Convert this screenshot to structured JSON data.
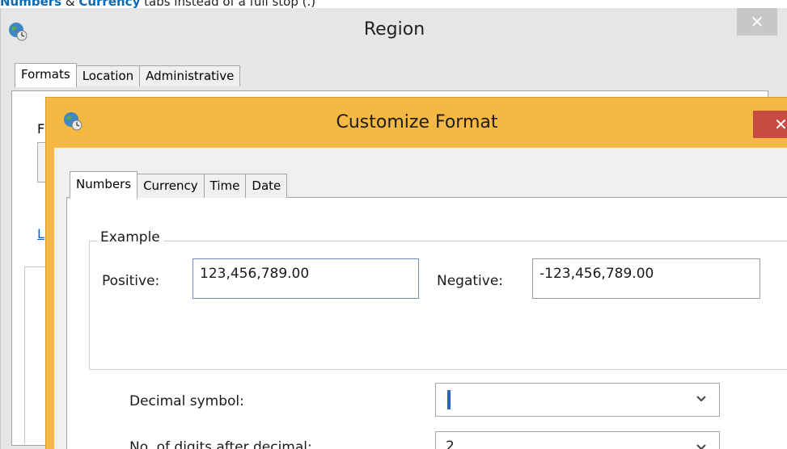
{
  "caption": {
    "highlight1": "Numbers",
    "connector": " & ",
    "highlight2": "Currency",
    "rest": " tabs instead of a full stop (.)"
  },
  "region_window": {
    "title": "Region",
    "close_glyph": "✕",
    "tabs": [
      {
        "label": "Formats",
        "active": true
      },
      {
        "label": "Location",
        "active": false
      },
      {
        "label": "Administrative",
        "active": false
      }
    ],
    "partial_format_label": "F",
    "partial_link": "L"
  },
  "customize_window": {
    "title": "Customize Format",
    "close_glyph": "✕",
    "tabs": [
      {
        "label": "Numbers",
        "active": true
      },
      {
        "label": "Currency",
        "active": false
      },
      {
        "label": "Time",
        "active": false
      },
      {
        "label": "Date",
        "active": false
      }
    ],
    "example": {
      "legend": "Example",
      "positive_label": "Positive:",
      "positive_value": "123,456,789.00",
      "negative_label": "Negative:",
      "negative_value": "-123,456,789.00"
    },
    "decimal_symbol_label": "Decimal symbol:",
    "digits_after_decimal_label": "No. of digits after decimal:",
    "digits_after_decimal_value": "2"
  },
  "icons": {
    "app": "globe-clock-icon",
    "dropdown": "chevron-down-icon",
    "close": "close-icon"
  },
  "colors": {
    "dialog_frame": "#f5b843",
    "close_active": "#c94a42",
    "close_inactive": "#c7c7c7",
    "caption_highlight": "#0a6ab3"
  }
}
